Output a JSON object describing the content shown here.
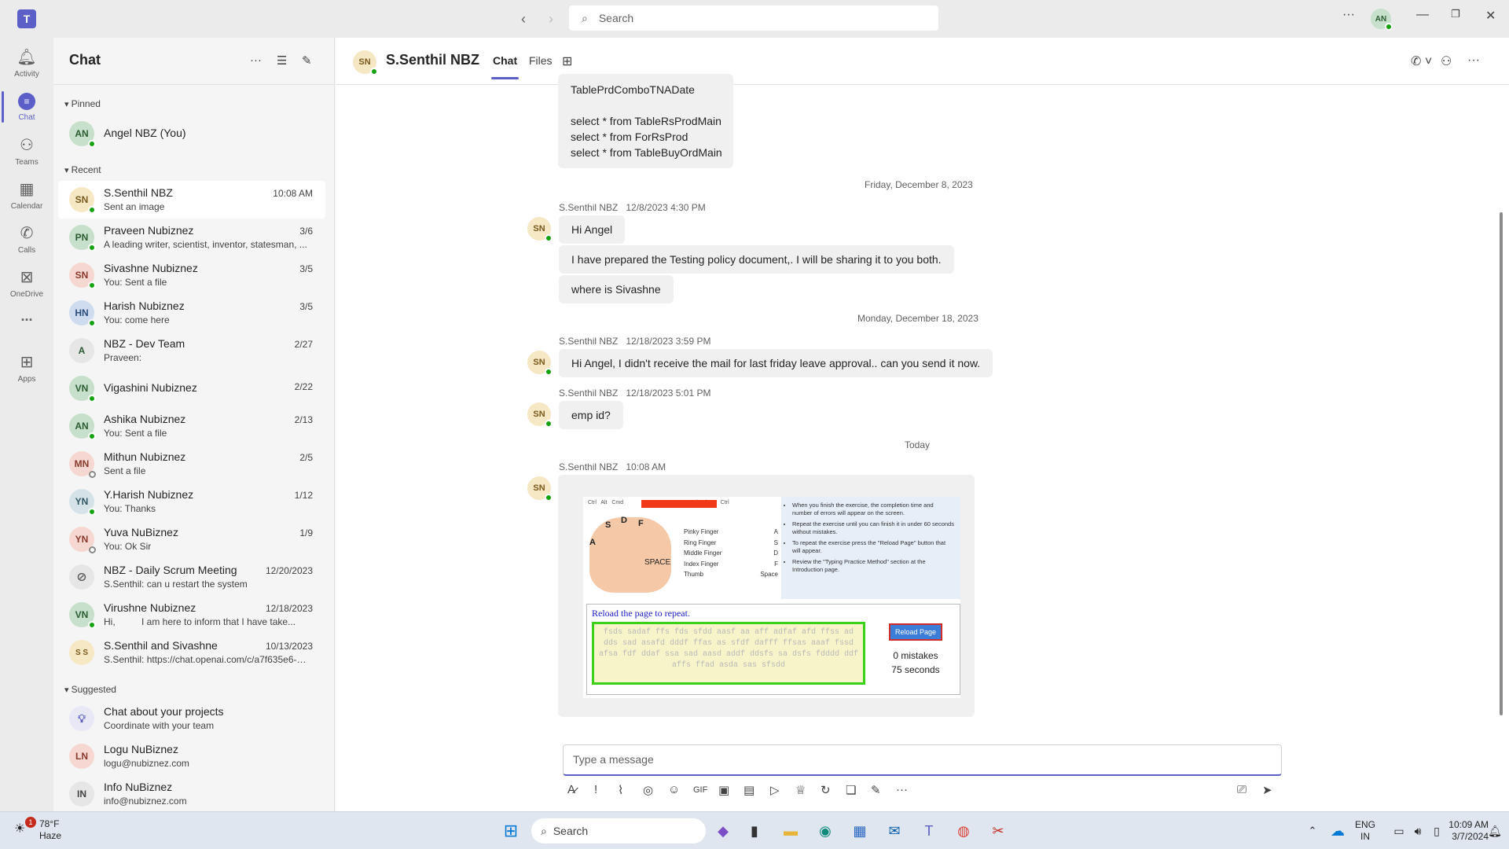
{
  "titlebar": {
    "search_placeholder": "Search",
    "user_initials": "AN"
  },
  "rail": {
    "items": [
      {
        "label": "Activity",
        "icon": "bell-icon"
      },
      {
        "label": "Chat",
        "icon": "chat-icon"
      },
      {
        "label": "Teams",
        "icon": "teams-icon"
      },
      {
        "label": "Calendar",
        "icon": "calendar-icon"
      },
      {
        "label": "Calls",
        "icon": "phone-icon"
      },
      {
        "label": "OneDrive",
        "icon": "onedrive-icon"
      },
      {
        "label": "...",
        "icon": "more-icon"
      },
      {
        "label": "Apps",
        "icon": "add-apps-icon"
      }
    ]
  },
  "chatlist": {
    "title": "Chat",
    "pinned_label": "Pinned",
    "recent_label": "Recent",
    "suggested_label": "Suggested",
    "pinned": [
      {
        "initials": "AN",
        "name": "Angel NBZ (You)"
      }
    ],
    "recent": [
      {
        "initials": "SN",
        "name": "S.Senthil NBZ",
        "time": "10:08 AM",
        "preview": "Sent an image"
      },
      {
        "initials": "PN",
        "name": "Praveen Nubiznez",
        "time": "3/6",
        "preview": "A leading writer, scientist, inventor, statesman, ..."
      },
      {
        "initials": "SN",
        "name": "Sivashne Nubiznez",
        "time": "3/5",
        "preview": "You: Sent a file"
      },
      {
        "initials": "HN",
        "name": "Harish Nubiznez",
        "time": "3/5",
        "preview": "You: come here"
      },
      {
        "initials": "A",
        "name": "NBZ - Dev Team",
        "time": "2/27",
        "preview": "Praveen:"
      },
      {
        "initials": "VN",
        "name": "Vigashini Nubiznez",
        "time": "2/22",
        "preview": ""
      },
      {
        "initials": "AN",
        "name": "Ashika Nubiznez",
        "time": "2/13",
        "preview": "You: Sent a file"
      },
      {
        "initials": "MN",
        "name": "Mithun Nubiznez",
        "time": "2/5",
        "preview": "Sent a file"
      },
      {
        "initials": "YN",
        "name": "Y.Harish Nubiznez",
        "time": "1/12",
        "preview": "You: Thanks"
      },
      {
        "initials": "YN",
        "name": "Yuva NuBiznez",
        "time": "1/9",
        "preview": "You: Ok Sir"
      },
      {
        "initials": "",
        "name": "NBZ - Daily Scrum Meeting",
        "time": "12/20/2023",
        "preview": "S.Senthil: can u restart the system"
      },
      {
        "initials": "VN",
        "name": "Virushne Nubiznez",
        "time": "12/18/2023",
        "preview": "Hi,          I am here to inform that I have take..."
      },
      {
        "initials": "S S",
        "name": "S.Senthil and Sivashne",
        "time": "10/13/2023",
        "preview": "S.Senthil: https://chat.openai.com/c/a7f635e6-a..."
      }
    ],
    "suggested": [
      {
        "initials": "",
        "name": "Chat about your projects",
        "preview": "Coordinate with your team"
      },
      {
        "initials": "LN",
        "name": "Logu NuBiznez",
        "preview": "logu@nubiznez.com"
      },
      {
        "initials": "IN",
        "name": "Info NuBiznez",
        "preview": "info@nubiznez.com"
      }
    ]
  },
  "conversation": {
    "initials": "SN",
    "name": "S.Senthil NBZ",
    "tabs": [
      "Chat",
      "Files"
    ],
    "code_lines": [
      "TablePrdComboTNADate",
      "",
      "select * from TableRsProdMain",
      "select * from ForRsProd",
      "select * from TableBuyOrdMain"
    ],
    "divider1": "Friday, December 8, 2023",
    "divider2": "Monday, December 18, 2023",
    "divider3": "Today",
    "m1_meta": "S.Senthil NBZ   12/8/2023 4:30 PM",
    "m1_b1": "Hi Angel",
    "m1_b2": "I have prepared the Testing policy document,. I will be sharing it to you both.",
    "m1_b3": "where is Sivashne",
    "m2_meta": "S.Senthil NBZ   12/18/2023 3:59 PM",
    "m2_b1": "Hi Angel, I didn't receive the mail for last friday leave approval.. can you send it now.",
    "m3_meta": "S.Senthil NBZ   12/18/2023 5:01 PM",
    "m3_b1": "emp id?",
    "m4_meta": "S.Senthil NBZ   10:08 AM",
    "image": {
      "keys": "Ctrl   Alt   Cmd                                         Cmd   Alt Gr   Ctrl",
      "letters": [
        "S",
        "D",
        "F",
        "A",
        "SPACE"
      ],
      "fingers": [
        "Pinky Finger",
        "Ring Finger",
        "Middle Finger",
        "Index Finger",
        "Thumb"
      ],
      "finger_keys": [
        "A",
        "S",
        "D",
        "F",
        "Space"
      ],
      "tips": [
        "When you finish the exercise, the completion time and number of errors will appear on the screen.",
        "Repeat the exercise until you can finish it in under 60 seconds without mistakes.",
        "To repeat the exercise press the \"Reload Page\" button that will appear.",
        "Review the \"Typing Practice Method\" section at the Introduction page."
      ],
      "reload_title": "Reload the page to repeat.",
      "typing_text": "fsds sadaf ffs fds sfdd aasf aa aff adfaf afd ffss ad dds sad asafd dddf ffas as sfdf dafff ffsas aaaf fssd afsa fdf ddaf ssa sad aasd addf ddsfs sa dsfs fdddd ddf affs ffad asda sas sfsdd",
      "reload_button": "Reload Page",
      "mistakes": "0 mistakes",
      "seconds": "75 seconds"
    },
    "compose_placeholder": "Type a message"
  },
  "taskbar": {
    "temp": "78°F",
    "weather": "Haze",
    "weather_badge": "1",
    "search": "Search",
    "lang1": "ENG",
    "lang2": "IN",
    "time": "10:09 AM",
    "date": "3/7/2024"
  },
  "colors": {
    "accent": "#5b5fc7",
    "presence_available": "#13a10e"
  }
}
